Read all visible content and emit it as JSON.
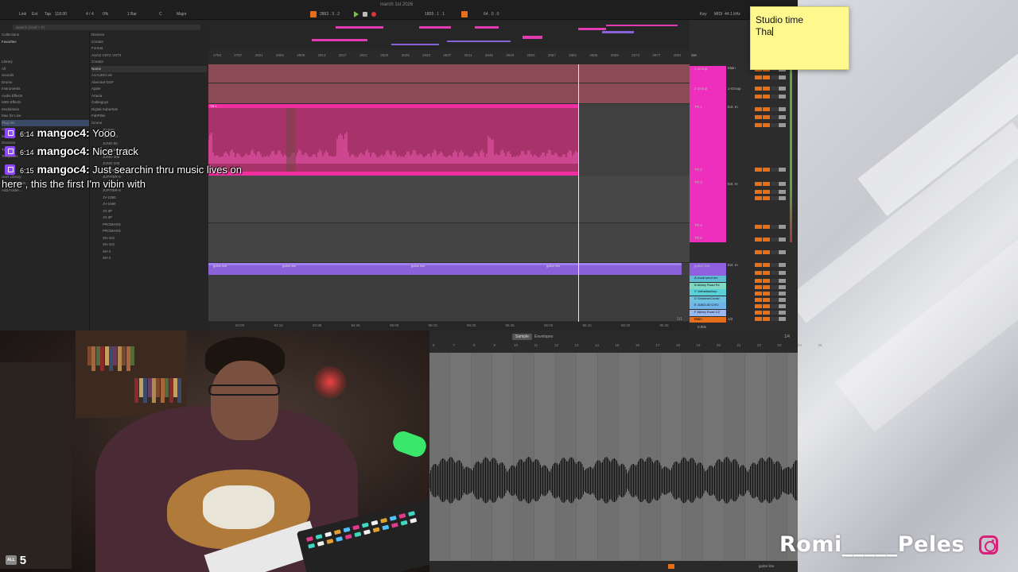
{
  "daw": {
    "document_title": "march 1st 2026",
    "topbar": {
      "link": "Link",
      "ext": "Ext",
      "tap": "Tap",
      "tempo": "118.00",
      "signature": "4 / 4",
      "cpu": "0%",
      "quantize": "1 Bar",
      "key": "C",
      "scale": "Major",
      "position": "2863 . 3 . 2",
      "loop_start": "1809 . 1 . 1",
      "loop_length": "64 . 0 . 0",
      "key_label": "Key",
      "midi_label": "MIDI",
      "sample_rate": "44.1 kHz"
    },
    "browser": {
      "search_placeholder": "Search (Cmd + F)",
      "collections_header": "Collections",
      "favorites": "Favorites",
      "library_header": "Library",
      "library_items": [
        "All",
        "Sounds",
        "Drums",
        "Instruments",
        "Audio Effects",
        "MIDI Effects",
        "Modulators",
        "Max for Live",
        "Plug-Ins",
        "Clips",
        "Samples",
        "Grooves",
        "Tunings",
        "Templates"
      ],
      "places_items": [
        "User Library",
        "Current Project",
        "Add Folder..."
      ],
      "filters": [
        "Devices",
        "Creator",
        "Format"
      ],
      "format_tags": [
        "AU/v2",
        "VST2",
        "VST3"
      ],
      "creator": "Creator",
      "name_header": "Name",
      "vendors": [
        "A1AUDIO.de",
        "Aberrant DSP",
        "Apple",
        "Arturia",
        "Cableguys",
        "Digital Suburban",
        "FabFilter",
        "Ozone"
      ],
      "presets": [
        "JD-800",
        "JUNO-60",
        "JUNO-60",
        "JUNO-60 CHORUS",
        "JUNO-106",
        "JUNO-106",
        "JUPITER-4",
        "JUPITER-6",
        "JUPITER-8",
        "JUPITER-8",
        "JV-1080",
        "JV-1080",
        "JX-3P",
        "JX-3P",
        "PROMARS",
        "PROMARS",
        "SH-101",
        "SH-101",
        "SH-2",
        "SH-2"
      ]
    },
    "ruler_ticks": [
      "2793",
      "2797",
      "2801",
      "2805",
      "2809",
      "2813",
      "2817",
      "2821",
      "2825",
      "2829",
      "2833",
      "2837",
      "2841",
      "2845",
      "2849",
      "2853",
      "2857",
      "2861",
      "2865",
      "2869",
      "2873",
      "2877",
      "2881"
    ],
    "time_ticks": [
      "94:00",
      "94:15",
      "94:30",
      "94:45",
      "95:00",
      "95:15",
      "95:30",
      "95:45",
      "96:00",
      "96:15",
      "96:30",
      "96:45"
    ],
    "pink_clip_label": "TR 1",
    "purple_clip_label": "guitar line",
    "page_counter": "1/1",
    "mixer": {
      "set_label": "Set",
      "group_label": "1-Group",
      "master_label": "Main",
      "ext_in": "Ext. In",
      "tracks": [
        "1 Group",
        "2 Group",
        "TR 1",
        "TR 2",
        "TR 3",
        "TR 4",
        "TR 5",
        "TR 6",
        "guitar line"
      ],
      "returns": [
        "A vocal send rev",
        "B Abbey Road Re",
        "C Valhallashimp",
        "D ShimmerConstr",
        "E JUNO-60 CHO",
        "F Abbey Road 1/2"
      ],
      "main": "Main",
      "footer_value": "0.00s",
      "main_routing": "1/2"
    },
    "colors": {
      "pink": "#f02ea0",
      "purple": "#8a62d8",
      "accent_orange": "#e86f1a"
    }
  },
  "detail": {
    "tabs": [
      "Sample",
      "Envelopes"
    ],
    "ruler_ticks": [
      "6",
      "7",
      "8",
      "9",
      "10",
      "11",
      "12",
      "13",
      "14",
      "15",
      "16",
      "17",
      "18",
      "19",
      "20",
      "21",
      "22",
      "23",
      "24",
      "25"
    ],
    "page": "1/4",
    "clip_name": "guitar line"
  },
  "sticky_note": {
    "line1": "Studio time",
    "line2": "Tha"
  },
  "chat": [
    {
      "time": "6:14",
      "user": "mangoc4:",
      "message": "Yooo"
    },
    {
      "time": "6:14",
      "user": "mangoc4:",
      "message": "Nice track"
    },
    {
      "time": "6:15",
      "user": "mangoc4:",
      "message": "Just searchin thru music lives on",
      "continuation": "here , this the first I'm vibin with"
    }
  ],
  "viewers": {
    "label": "ALL",
    "count": "5"
  },
  "watermark": {
    "name": "Romi_____Peles",
    "icon": "instagram-icon"
  }
}
